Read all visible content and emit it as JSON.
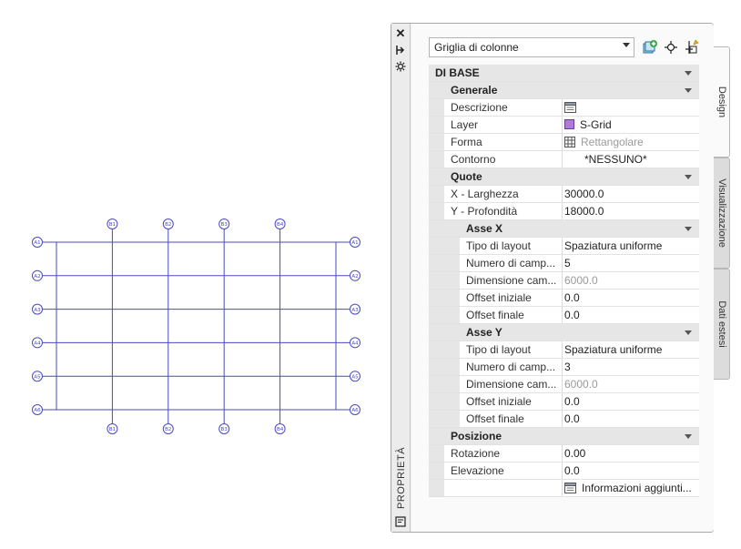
{
  "grid": {
    "x_bubbles_top": [
      "B1",
      "B2",
      "B3",
      "B4"
    ],
    "x_bubbles_bottom": [
      "B1",
      "B2",
      "B3",
      "B4"
    ],
    "y_bubbles_left": [
      "A1",
      "A2",
      "A3",
      "A4",
      "A5",
      "A6"
    ],
    "y_bubbles_right": [
      "A1",
      "A2",
      "A3",
      "A4",
      "A5",
      "A6"
    ],
    "line_color": "#4a4ac0"
  },
  "panel": {
    "side_title": "PROPRIETÀ",
    "type_selector": "Griglia di colonne",
    "tabs": [
      "Design",
      "Visualizzazione",
      "Dati estesi"
    ],
    "icons": [
      "close-icon",
      "pin-icon",
      "settings-icon",
      "panel-icon",
      "add-style-icon",
      "pick-point-icon",
      "quick-select-icon"
    ]
  },
  "properties": [
    {
      "type": "cat",
      "label": "DI BASE",
      "level": 0
    },
    {
      "type": "cat",
      "label": "Generale",
      "level": 1
    },
    {
      "type": "prop",
      "name": "Descrizione",
      "value": "",
      "icon": "description-icon",
      "level": 1
    },
    {
      "type": "prop",
      "name": "Layer",
      "value": "S-Grid",
      "icon": "layer-swatch-icon",
      "level": 1
    },
    {
      "type": "prop",
      "name": "Forma",
      "value": "Rettangolare",
      "icon": "grid-shape-icon",
      "disabled": true,
      "level": 1
    },
    {
      "type": "prop",
      "name": "Contorno",
      "value": "*NESSUNO*",
      "indent_value": true,
      "level": 1
    },
    {
      "type": "cat",
      "label": "Quote",
      "level": 1
    },
    {
      "type": "prop",
      "name": "X - Larghezza",
      "value": "30000.0",
      "level": 1
    },
    {
      "type": "prop",
      "name": "Y - Profondità",
      "value": "18000.0",
      "level": 1
    },
    {
      "type": "cat",
      "label": "Asse X",
      "level": 2
    },
    {
      "type": "prop",
      "name": "Tipo di layout",
      "value": "Spaziatura uniforme",
      "level": 2
    },
    {
      "type": "prop",
      "name": "Numero di camp...",
      "value": "5",
      "level": 2
    },
    {
      "type": "prop",
      "name": "Dimensione cam...",
      "value": "6000.0",
      "disabled": true,
      "level": 2
    },
    {
      "type": "prop",
      "name": "Offset iniziale",
      "value": "0.0",
      "level": 2
    },
    {
      "type": "prop",
      "name": "Offset finale",
      "value": "0.0",
      "level": 2
    },
    {
      "type": "cat",
      "label": "Asse Y",
      "level": 2
    },
    {
      "type": "prop",
      "name": "Tipo di layout",
      "value": "Spaziatura uniforme",
      "level": 2
    },
    {
      "type": "prop",
      "name": "Numero di camp...",
      "value": "3",
      "level": 2
    },
    {
      "type": "prop",
      "name": "Dimensione cam...",
      "value": "6000.0",
      "disabled": true,
      "level": 2
    },
    {
      "type": "prop",
      "name": "Offset iniziale",
      "value": "0.0",
      "level": 2
    },
    {
      "type": "prop",
      "name": "Offset finale",
      "value": "0.0",
      "level": 2
    },
    {
      "type": "cat",
      "label": "Posizione",
      "level": 1
    },
    {
      "type": "prop",
      "name": "Rotazione",
      "value": "0.00",
      "level": 1
    },
    {
      "type": "prop",
      "name": "Elevazione",
      "value": "0.0",
      "level": 1
    },
    {
      "type": "prop",
      "name": "",
      "value": "Informazioni  aggiunti...",
      "icon": "info-icon",
      "level": 1
    }
  ]
}
